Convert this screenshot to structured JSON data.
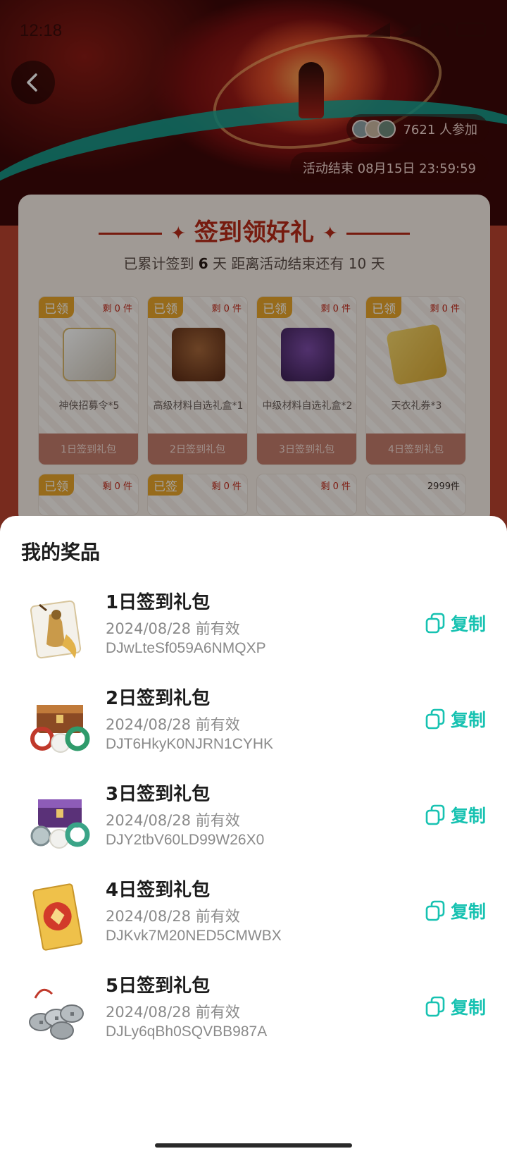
{
  "status": {
    "time": "12:18"
  },
  "activity": {
    "participants": "7621 人参加",
    "end_time": "活动结束 08月15日 23:59:59",
    "card_title": "签到领好礼",
    "summary_prefix": "已累计签到",
    "signed_days": "6",
    "summary_suffix": "天   距离活动结束还有 10 天",
    "days": [
      {
        "tag": "已领",
        "remain": "剩 0 件",
        "name": "神侠招募令*5",
        "footer": "1日签到礼包"
      },
      {
        "tag": "已领",
        "remain": "剩 0 件",
        "name": "高级材料自选礼盒*1",
        "footer": "2日签到礼包"
      },
      {
        "tag": "已领",
        "remain": "剩 0 件",
        "name": "中级材料自选礼盒*2",
        "footer": "3日签到礼包"
      },
      {
        "tag": "已领",
        "remain": "剩 0 件",
        "name": "天衣礼券*3",
        "footer": "4日签到礼包"
      },
      {
        "tag": "已领",
        "remain": "剩 0 件"
      },
      {
        "tag": "已签",
        "remain": "剩 0 件"
      },
      {
        "remain": "剩 0 件"
      },
      {
        "remain": "2999件"
      }
    ]
  },
  "sheet": {
    "title": "我的奖品",
    "copy_label": "复制",
    "prizes": [
      {
        "name": "1日签到礼包",
        "valid": "2024/08/28 前有效",
        "code": "DJwLteSf059A6NMQXP",
        "icon": "recruit-token-icon"
      },
      {
        "name": "2日签到礼包",
        "valid": "2024/08/28 前有效",
        "code": "DJT6HkyK0NJRN1CYHK",
        "icon": "treasure-chest-icon"
      },
      {
        "name": "3日签到礼包",
        "valid": "2024/08/28 前有效",
        "code": "DJY2tbV60LD99W26X0",
        "icon": "purple-chest-icon"
      },
      {
        "name": "4日签到礼包",
        "valid": "2024/08/28 前有效",
        "code": "DJKvk7M20NED5CMWBX",
        "icon": "coupon-icon"
      },
      {
        "name": "5日签到礼包",
        "valid": "2024/08/28 前有效",
        "code": "DJLy6qBh0SQVBB987A",
        "icon": "coin-string-icon"
      }
    ]
  },
  "colors": {
    "accent": "#17c2b1",
    "tag": "#e9a52a",
    "brand_red": "#b62a17"
  }
}
